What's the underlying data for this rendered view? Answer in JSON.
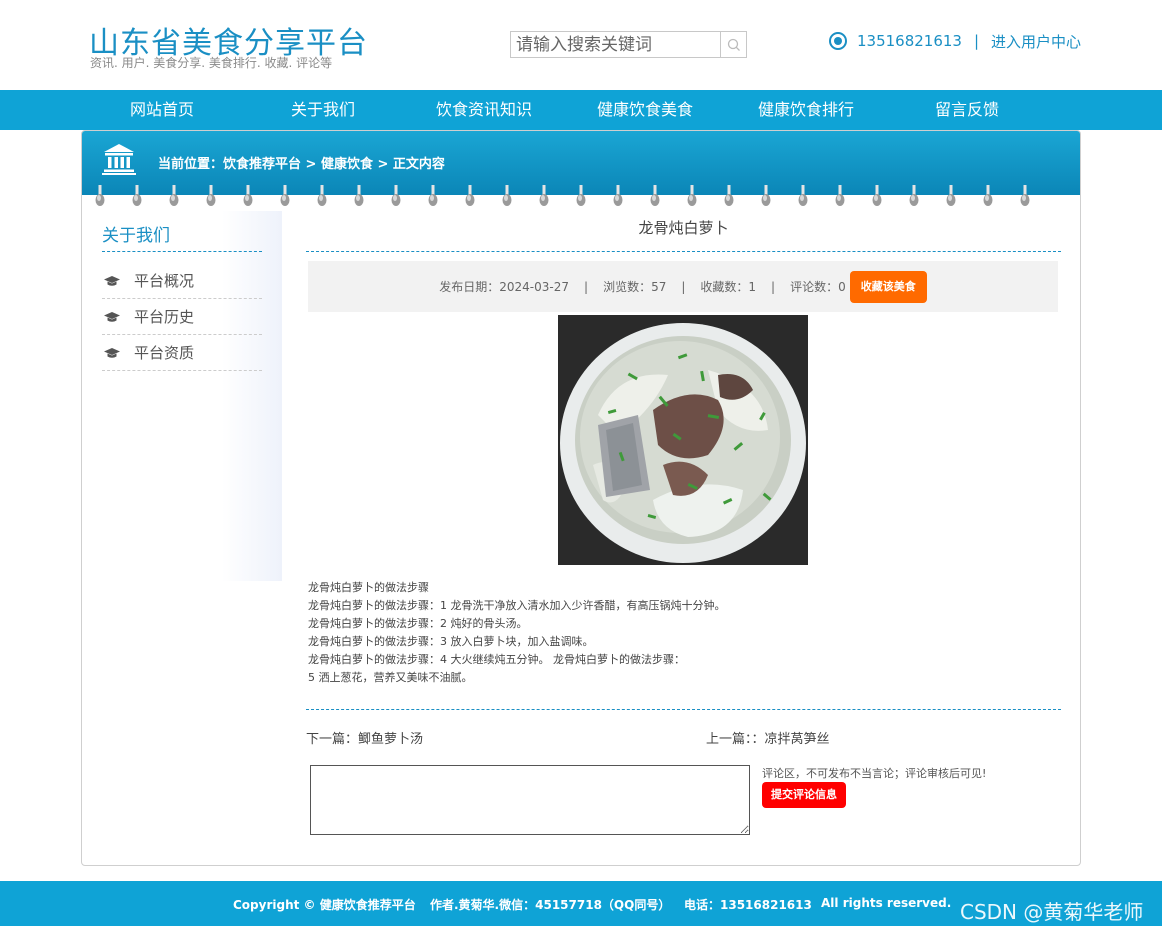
{
  "header": {
    "title": "山东省美食分享平台",
    "subtitle": "资讯. 用户. 美食分享. 美食排行. 收藏. 评论等",
    "search_placeholder": "请输入搜索关键词",
    "phone": "13516821613",
    "separator": "|",
    "user_center": "进入用户中心"
  },
  "nav": {
    "items": [
      "网站首页",
      "关于我们",
      "饮食资讯知识",
      "健康饮食美食",
      "健康饮食排行",
      "留言反馈"
    ]
  },
  "breadcrumb": "当前位置：饮食推荐平台 > 健康饮食 > 正文内容",
  "sidebar": {
    "title": "关于我们",
    "items": [
      "平台概况",
      "平台历史",
      "平台资质"
    ]
  },
  "article": {
    "title": "龙骨炖白萝卜",
    "publish_date": "发布日期：2024-03-27",
    "views": "浏览数：57",
    "favorites": "收藏数：1",
    "comments": "评论数：0",
    "meta_separator": "|",
    "favorite_button": "收藏该美食",
    "steps": [
      "龙骨炖白萝卜的做法步骤",
      "龙骨炖白萝卜的做法步骤：1 龙骨洗干净放入清水加入少许香醋，有高压锅炖十分钟。",
      "龙骨炖白萝卜的做法步骤：2 炖好的骨头汤。",
      "龙骨炖白萝卜的做法步骤：3 放入白萝卜块，加入盐调味。",
      "龙骨炖白萝卜的做法步骤：4 大火继续炖五分钟。 龙骨炖白萝卜的做法步骤：",
      "5 洒上葱花，营养又美味不油腻。"
    ],
    "next_label": "下一篇：鲫鱼萝卜汤",
    "prev_label": "上一篇：：凉拌莴笋丝"
  },
  "comment": {
    "placeholder": "",
    "note": "评论区，不可发布不当言论；评论审核后可见!",
    "submit": "提交评论信息"
  },
  "footer": {
    "copyright": "Copyright © 健康饮食推荐平台",
    "author": "作者.黄菊华.微信：45157718（QQ同号）",
    "phone": "电话：13516821613",
    "rights": "All rights reserved.",
    "watermark": "CSDN @黄菊华老师"
  },
  "colors": {
    "primary": "#0fa3d6",
    "title_blue": "#1a8fc4",
    "favorite_orange": "#ff6a00",
    "submit_red": "#ff0000"
  }
}
